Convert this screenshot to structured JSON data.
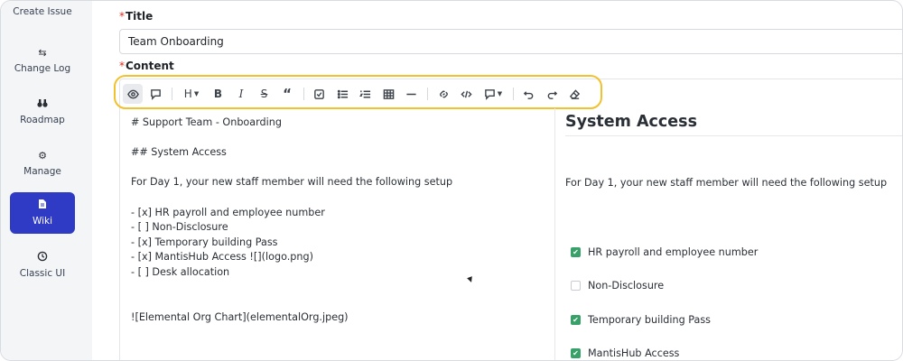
{
  "sidebar": {
    "top_item": "Create Issue",
    "items": [
      {
        "label": "Change Log",
        "icon": "swap-arrows-icon"
      },
      {
        "label": "Roadmap",
        "icon": "binoculars-icon"
      },
      {
        "label": "Manage",
        "icon": "gears-icon"
      },
      {
        "label": "Wiki",
        "icon": "document-icon",
        "active": true
      },
      {
        "label": "Classic UI",
        "icon": "history-icon"
      }
    ]
  },
  "form": {
    "title_label": "Title",
    "title_value": "Team Onboarding",
    "content_label": "Content",
    "required_mark": "*"
  },
  "toolbar": {
    "heading_label": "H"
  },
  "source_lines": [
    "# Support Team - Onboarding",
    "## System Access",
    "For Day 1, your new staff member will need the following setup",
    "- [x] HR payroll and employee number",
    "- [ ] Non-Disclosure",
    "- [x] Temporary building Pass",
    "- [x] MantisHub Access ![](logo.png)",
    "- [ ] Desk allocation",
    "![Elemental Org Chart](elementalOrg.jpeg)"
  ],
  "preview": {
    "heading": "System Access",
    "paragraph": "For Day 1, your new staff member will need the following setup",
    "tasks": [
      {
        "label": "HR payroll and employee number",
        "checked": true
      },
      {
        "label": "Non-Disclosure",
        "checked": false
      },
      {
        "label": "Temporary building Pass",
        "checked": true
      },
      {
        "label": "MantisHub Access",
        "checked": true
      }
    ]
  },
  "colors": {
    "active_nav": "#2f3bc4",
    "highlight": "#f2c12e",
    "checkbox_checked": "#38a169",
    "required": "#d92d20"
  }
}
